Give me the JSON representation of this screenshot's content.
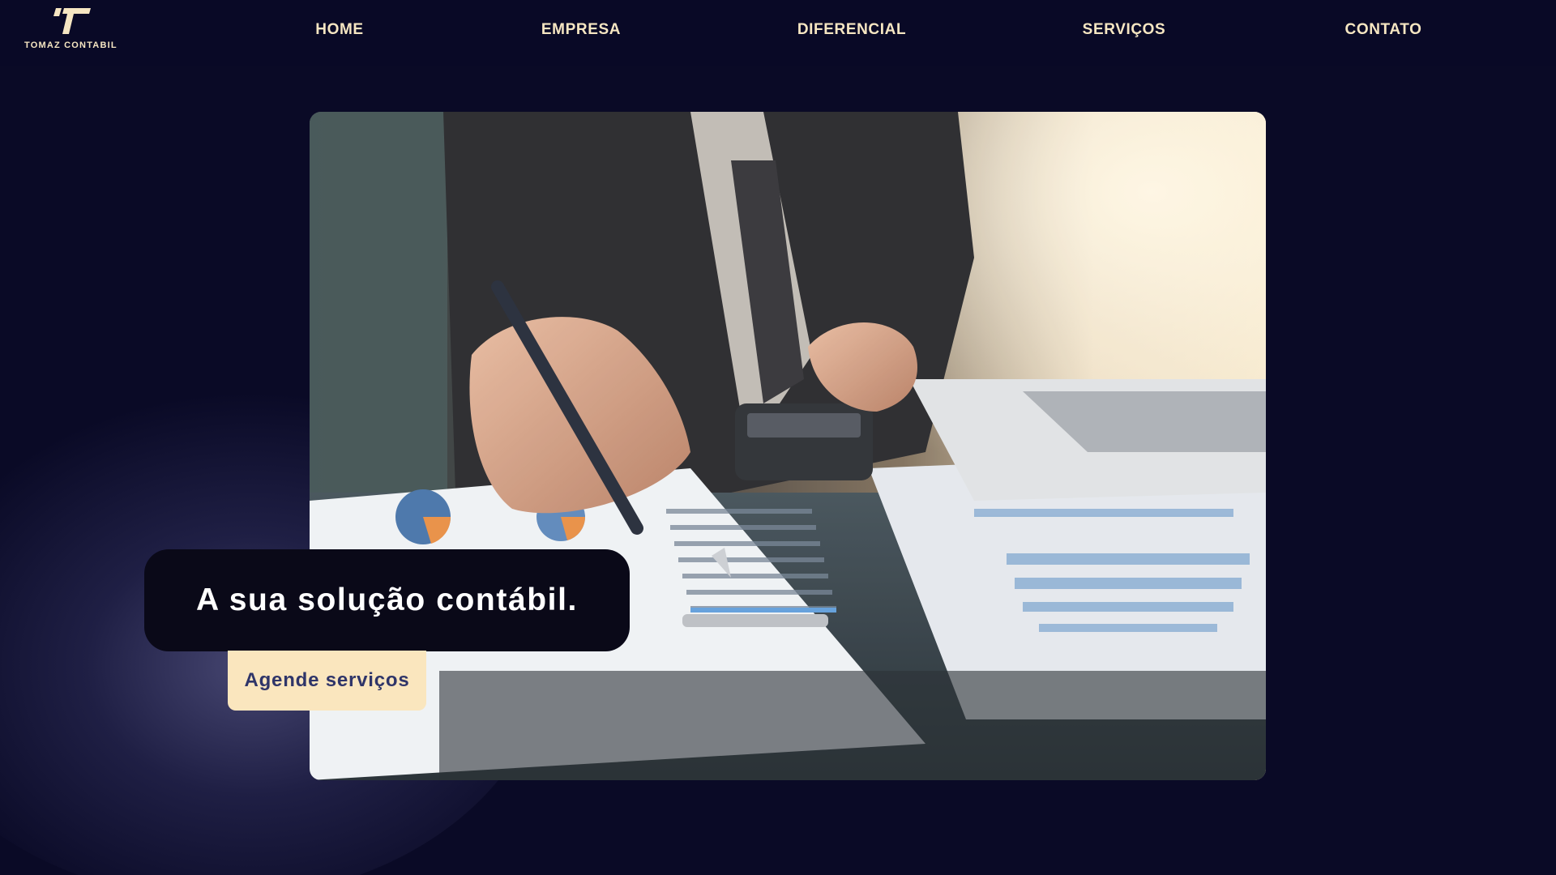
{
  "brand": {
    "name": "TOMAZ CONTABIL",
    "logo_icon": "t-monogram-icon",
    "color": "#f6e6c2"
  },
  "nav": {
    "items": [
      {
        "label": "HOME"
      },
      {
        "label": "EMPRESA"
      },
      {
        "label": "DIFERENCIAL"
      },
      {
        "label": "SERVIÇOS"
      },
      {
        "label": "CONTATO"
      }
    ]
  },
  "hero": {
    "tagline": "A sua solução contábil.",
    "cta_label": "Agende serviços"
  },
  "colors": {
    "background": "#0a0a26",
    "accent": "#fae6be",
    "cta_text": "#2f3569"
  }
}
